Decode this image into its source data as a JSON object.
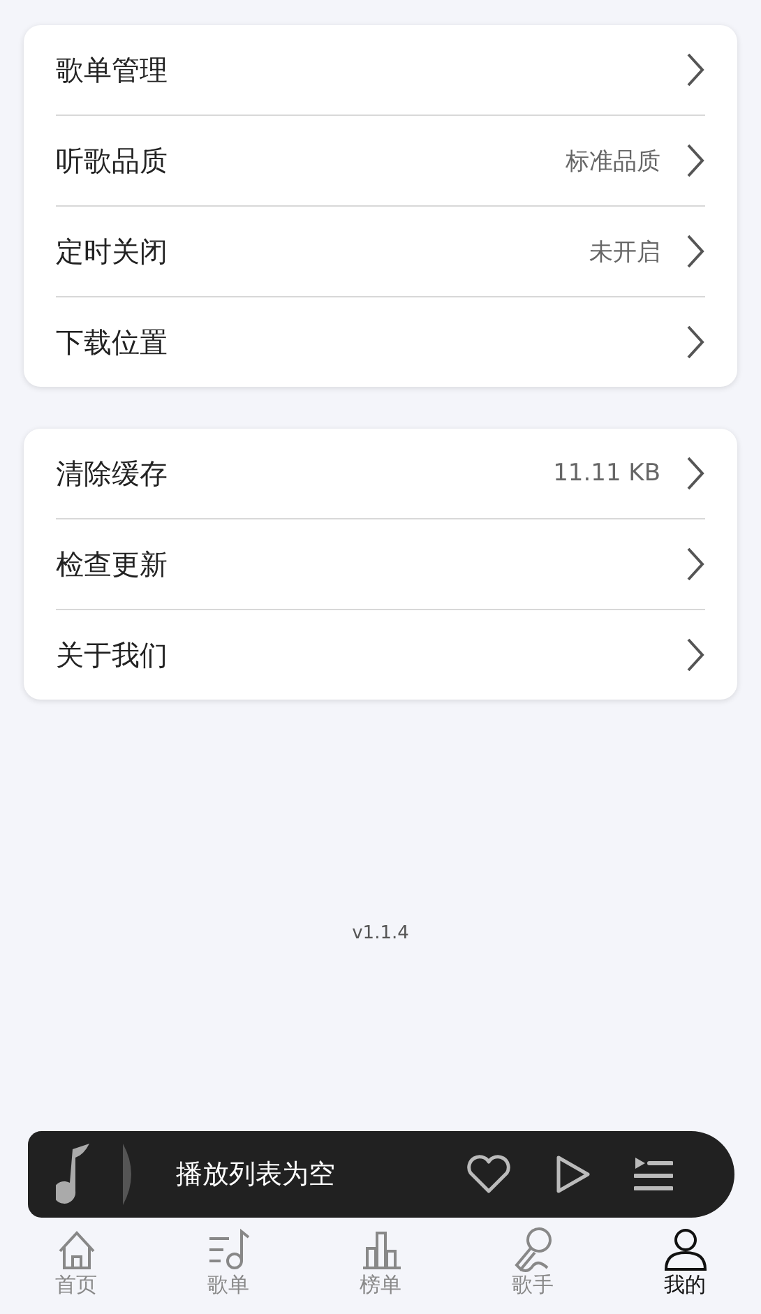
{
  "settings_groups": [
    {
      "items": [
        {
          "label": "歌单管理"
        },
        {
          "label": "听歌品质",
          "value": "标准品质"
        },
        {
          "label": "定时关闭",
          "value": "未开启"
        },
        {
          "label": "下载位置"
        }
      ]
    },
    {
      "items": [
        {
          "label": "清除缓存",
          "value": "11.11 KB"
        },
        {
          "label": "检查更新"
        },
        {
          "label": "关于我们"
        }
      ]
    }
  ],
  "version": "v1.1.4",
  "player": {
    "status_text": "播放列表为空",
    "liked": false
  },
  "nav": [
    {
      "label": "首页",
      "kind": "home",
      "selected": false
    },
    {
      "label": "歌单",
      "kind": "playlist",
      "selected": false
    },
    {
      "label": "榜单",
      "kind": "chart",
      "selected": false
    },
    {
      "label": "歌手",
      "kind": "singer",
      "selected": false
    },
    {
      "label": "我的",
      "kind": "me",
      "selected": true
    }
  ]
}
